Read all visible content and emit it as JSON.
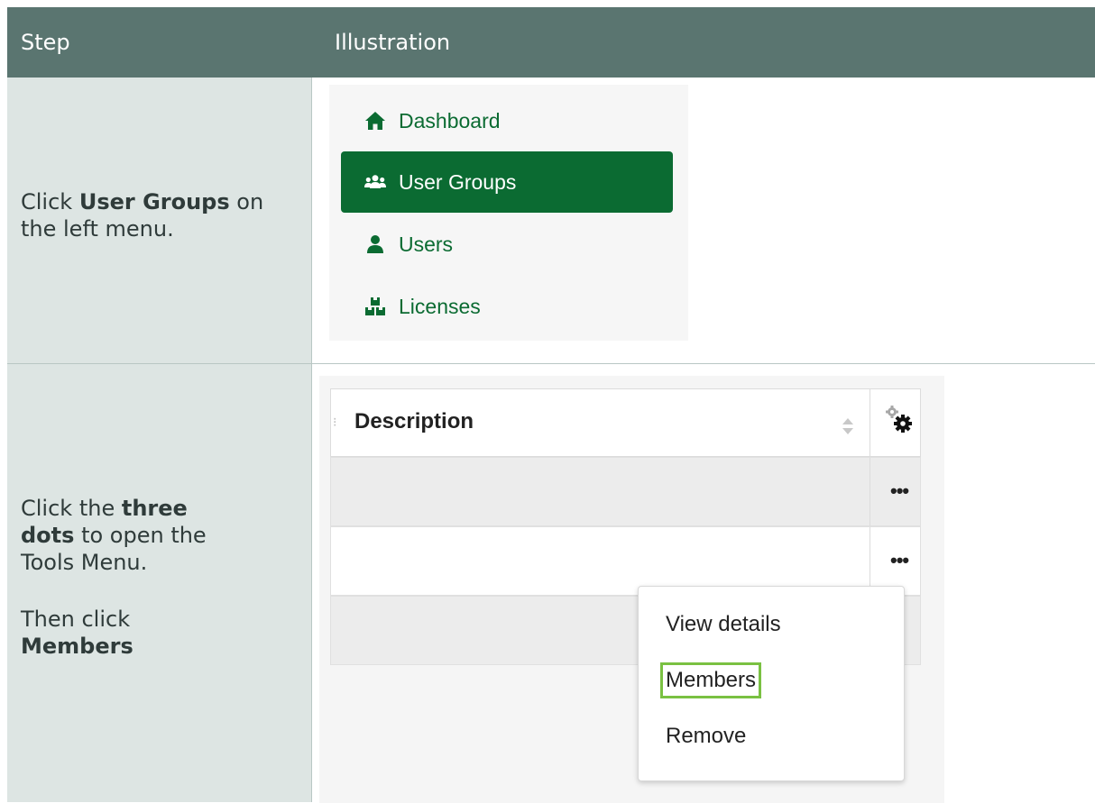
{
  "header": {
    "step_label": "Step",
    "illustration_label": "Illustration"
  },
  "rows": [
    {
      "instruction": {
        "pre": "Click ",
        "bold": "User Groups",
        "post": " on the left menu."
      },
      "menu": {
        "items": [
          {
            "label": "Dashboard",
            "icon": "home-icon",
            "active": false
          },
          {
            "label": "User Groups",
            "icon": "user-groups-icon",
            "active": true
          },
          {
            "label": "Users",
            "icon": "user-icon",
            "active": false
          },
          {
            "label": "Licenses",
            "icon": "licenses-icon",
            "active": false
          }
        ]
      }
    },
    {
      "instruction": {
        "p1_pre": "Click the ",
        "p1_bold": "three dots",
        "p1_post": " to open the Tools Menu.",
        "p2_pre": "Then click ",
        "p2_bold": "Members"
      },
      "table": {
        "column_header": "Description",
        "row_action": "•••",
        "tools_menu": [
          "View details",
          "Members",
          "Remove"
        ],
        "highlighted_item": "Members"
      }
    }
  ],
  "colors": {
    "header_bg": "#5a7570",
    "step_col_bg": "#dde5e3",
    "brand_green": "#0b6b32",
    "highlight_green": "#7ac142"
  }
}
